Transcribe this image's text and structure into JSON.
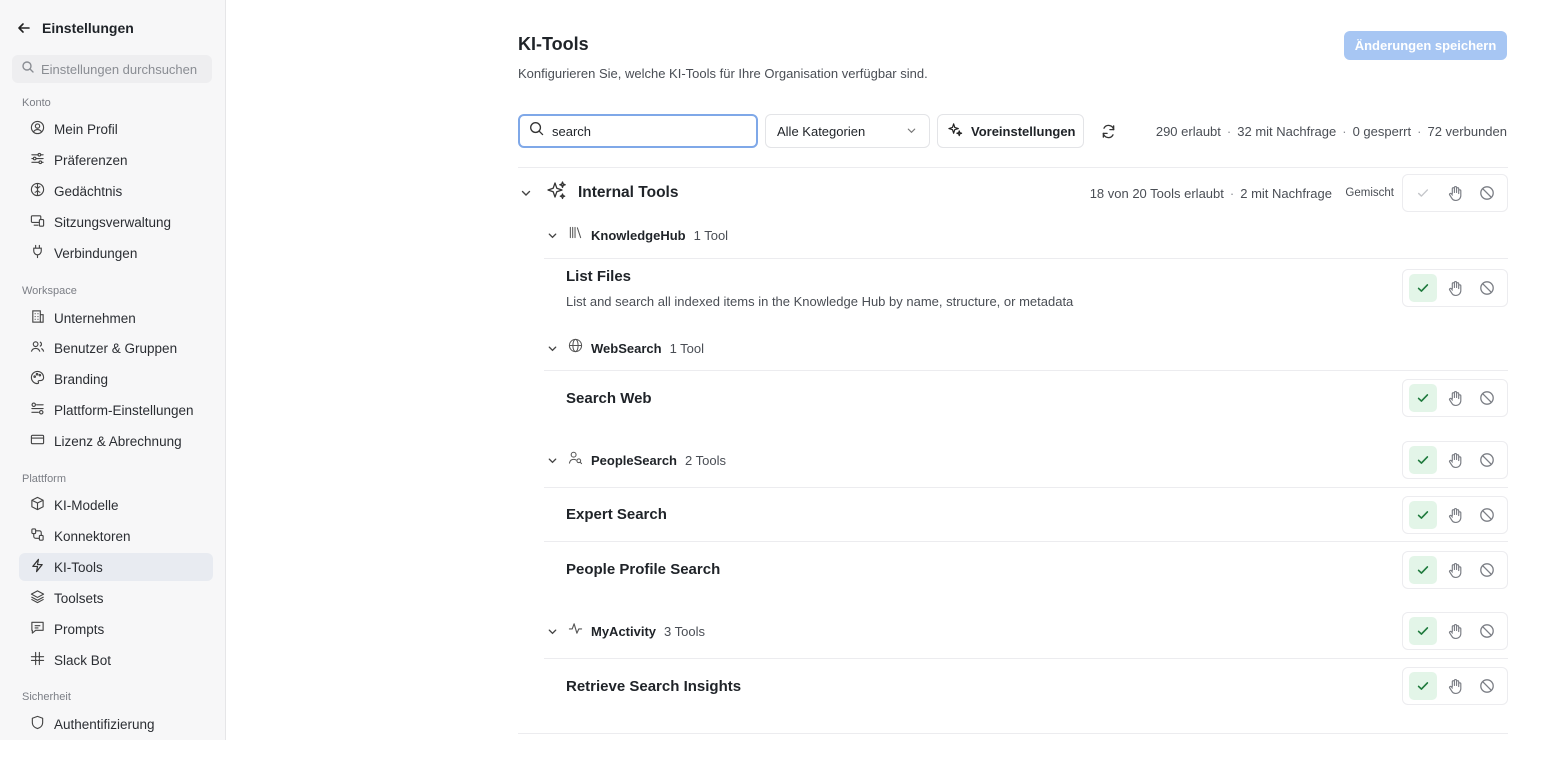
{
  "sidebar": {
    "title": "Einstellungen",
    "search_placeholder": "Einstellungen durchsuchen",
    "sections": [
      {
        "label": "Konto",
        "items": [
          {
            "label": "Mein Profil",
            "icon": "user-circle-icon"
          },
          {
            "label": "Präferenzen",
            "icon": "sliders-icon"
          },
          {
            "label": "Gedächtnis",
            "icon": "brain-icon"
          },
          {
            "label": "Sitzungsverwaltung",
            "icon": "devices-icon"
          },
          {
            "label": "Verbindungen",
            "icon": "plug-icon"
          }
        ]
      },
      {
        "label": "Workspace",
        "items": [
          {
            "label": "Unternehmen",
            "icon": "building-icon"
          },
          {
            "label": "Benutzer & Gruppen",
            "icon": "users-icon"
          },
          {
            "label": "Branding",
            "icon": "palette-icon"
          },
          {
            "label": "Plattform-Einstellungen",
            "icon": "settings-icon"
          },
          {
            "label": "Lizenz & Abrechnung",
            "icon": "credit-card-icon"
          }
        ]
      },
      {
        "label": "Plattform",
        "items": [
          {
            "label": "KI-Modelle",
            "icon": "cube-icon"
          },
          {
            "label": "Konnektoren",
            "icon": "connector-icon"
          },
          {
            "label": "KI-Tools",
            "icon": "zap-icon",
            "active": true
          },
          {
            "label": "Toolsets",
            "icon": "layers-icon"
          },
          {
            "label": "Prompts",
            "icon": "message-icon"
          },
          {
            "label": "Slack Bot",
            "icon": "slack-icon"
          }
        ]
      },
      {
        "label": "Sicherheit",
        "items": [
          {
            "label": "Authentifizierung",
            "icon": "shield-icon"
          }
        ]
      }
    ]
  },
  "header": {
    "title": "KI-Tools",
    "subtitle": "Konfigurieren Sie, welche KI-Tools für Ihre Organisation verfügbar sind.",
    "save_label": "Änderungen speichern"
  },
  "toolbar": {
    "search_value": "search",
    "category_label": "Alle Kategorien",
    "presets_label": "Voreinstellungen",
    "stats": {
      "allowed": "290 erlaubt",
      "ask": "32 mit Nachfrage",
      "blocked": "0 gesperrt",
      "connected": "72 verbunden"
    }
  },
  "group": {
    "title": "Internal Tools",
    "allowed_summary": "18 von 20 Tools erlaubt",
    "ask_summary": "2 mit Nachfrage",
    "state_label": "Gemischt",
    "subgroups": [
      {
        "name": "KnowledgeHub",
        "count": "1 Tool",
        "icon": "library-icon",
        "tools": [
          {
            "name": "List Files",
            "description": "List and search all indexed items in the Knowledge Hub by name, structure, or metadata"
          }
        ]
      },
      {
        "name": "WebSearch",
        "count": "1 Tool",
        "icon": "globe-icon",
        "tools": [
          {
            "name": "Search Web"
          }
        ]
      },
      {
        "name": "PeopleSearch",
        "count": "2 Tools",
        "icon": "person-search-icon",
        "tools": [
          {
            "name": "Expert Search"
          },
          {
            "name": "People Profile Search"
          }
        ]
      },
      {
        "name": "MyActivity",
        "count": "3 Tools",
        "icon": "activity-icon",
        "tools": [
          {
            "name": "Retrieve Search Insights"
          }
        ]
      }
    ]
  },
  "colors": {
    "accent": "#a7c6f3",
    "allowed_bg": "#e3f5e8",
    "allowed_check": "#1f7a3d",
    "focus_border": "#7fa8e8",
    "active_nav": "#e8ebf1"
  }
}
